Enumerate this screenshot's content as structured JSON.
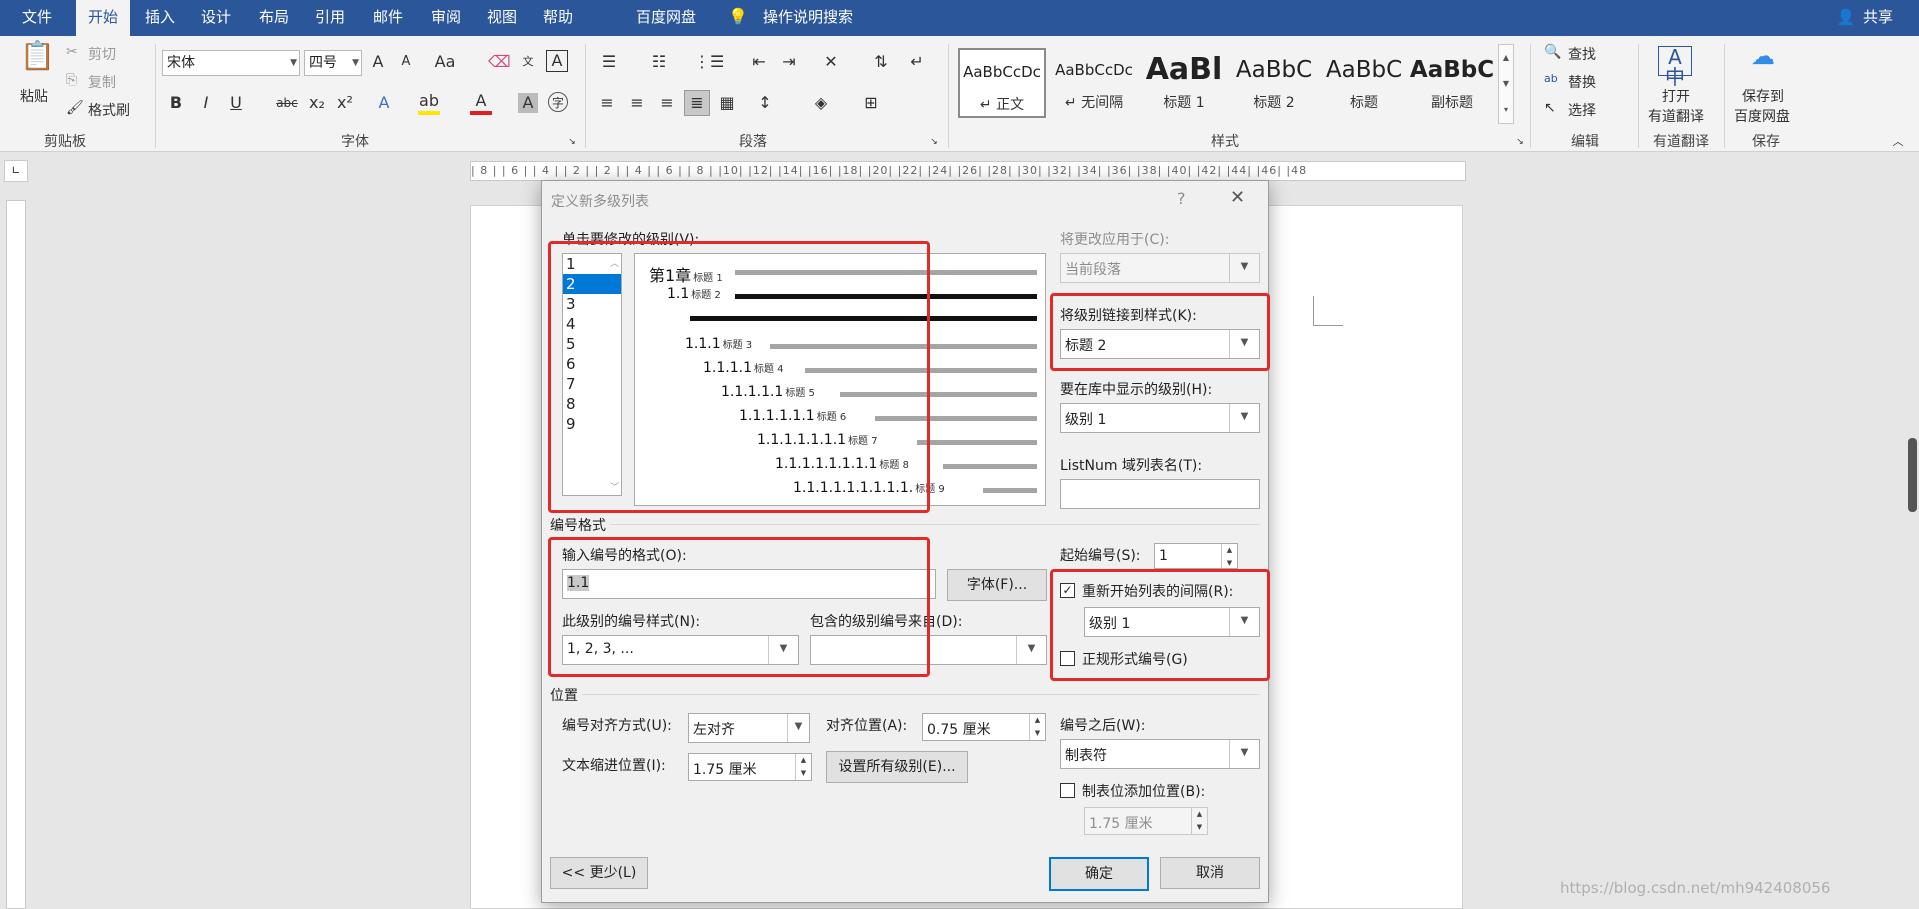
{
  "menubar": {
    "tabs": [
      "文件",
      "开始",
      "插入",
      "设计",
      "布局",
      "引用",
      "邮件",
      "审阅",
      "视图",
      "帮助",
      "百度网盘"
    ],
    "active": "开始",
    "search": "操作说明搜索",
    "share": "共享"
  },
  "ribbon": {
    "clipboard": {
      "paste": "粘贴",
      "cut": "剪切",
      "copy": "复制",
      "format_painter": "格式刷",
      "label": "剪贴板"
    },
    "font": {
      "name": "宋体",
      "size": "四号",
      "label": "字体",
      "grow": "A",
      "shrink": "A",
      "case": "Aa",
      "bold": "B",
      "italic": "I",
      "underline": "U",
      "strike": "abc",
      "sub": "x₂",
      "sup": "x²"
    },
    "paragraph": {
      "label": "段落"
    },
    "styles": {
      "label": "样式",
      "items": [
        {
          "preview": "AaBbCcDc",
          "name": "↵ 正文"
        },
        {
          "preview": "AaBbCcDc",
          "name": "↵ 无间隔"
        },
        {
          "preview": "AaBl",
          "name": "标题 1"
        },
        {
          "preview": "AaBbC",
          "name": "标题 2"
        },
        {
          "preview": "AaBbC",
          "name": "标题"
        },
        {
          "preview": "AaBbC",
          "name": "副标题"
        }
      ]
    },
    "editing": {
      "find": "查找",
      "replace": "替换",
      "select": "选择",
      "label": "编辑"
    },
    "youdao": {
      "open": "打开",
      "translate": "有道翻译",
      "label": "有道翻译"
    },
    "baidu": {
      "save": "保存到",
      "disk": "百度网盘",
      "label": "保存"
    }
  },
  "ruler": {
    "text": "| 8 |  | 6 |  | 4 |  | 2 |      | 2 |  | 4 |  | 6 |  | 8 |  |10|  |12|  |14|  |16|  |18|  |20|  |22|  |24|  |26|  |28|  |30|  |32|  |34|  |36|  |38|      |40|  |42|  |44|  |46|  |48"
  },
  "dialog": {
    "title": "定义新多级列表",
    "help": "?",
    "close": "✕",
    "level_label": "单击要修改的级别(V):",
    "levels": [
      "1",
      "2",
      "3",
      "4",
      "5",
      "6",
      "7",
      "8",
      "9"
    ],
    "selected_level": "2",
    "preview": [
      {
        "num": "第1章",
        "tag": "标题 1"
      },
      {
        "num": "1.1",
        "tag": "标题 2"
      },
      {
        "num": "1.1.1",
        "tag": "标题 3"
      },
      {
        "num": "1.1.1.1",
        "tag": "标题 4"
      },
      {
        "num": "1.1.1.1.1",
        "tag": "标题 5"
      },
      {
        "num": "1.1.1.1.1.1",
        "tag": "标题 6"
      },
      {
        "num": "1.1.1.1.1.1.1",
        "tag": "标题 7"
      },
      {
        "num": "1.1.1.1.1.1.1.1",
        "tag": "标题 8"
      },
      {
        "num": "1.1.1.1.1.1.1.1.1.",
        "tag": "标题 9"
      }
    ],
    "apply_to_label": "将更改应用于(C):",
    "apply_to_value": "当前段落",
    "link_style_label": "将级别链接到样式(K):",
    "link_style_value": "标题 2",
    "gallery_level_label": "要在库中显示的级别(H):",
    "gallery_level_value": "级别 1",
    "listnum_label": "ListNum 域列表名(T):",
    "listnum_value": "",
    "number_format_section": "编号格式",
    "enter_format_label": "输入编号的格式(O):",
    "enter_format_value": "1.1",
    "font_button": "字体(F)...",
    "number_style_label": "此级别的编号样式(N):",
    "number_style_value": "1, 2, 3, ...",
    "include_from_label": "包含的级别编号来自(D):",
    "include_from_value": "",
    "start_at_label": "起始编号(S):",
    "start_at_value": "1",
    "restart_label": "重新开始列表的间隔(R):",
    "restart_checked": true,
    "restart_value": "级别 1",
    "legal_label": "正规形式编号(G)",
    "legal_checked": false,
    "position_section": "位置",
    "alignment_label": "编号对齐方式(U):",
    "alignment_value": "左对齐",
    "aligned_at_label": "对齐位置(A):",
    "aligned_at_value": "0.75 厘米",
    "indent_label": "文本缩进位置(I):",
    "indent_value": "1.75 厘米",
    "set_all_button": "设置所有级别(E)...",
    "follow_label": "编号之后(W):",
    "follow_value": "制表符",
    "tab_add_label": "制表位添加位置(B):",
    "tab_add_checked": false,
    "tab_add_value": "1.75 厘米",
    "less_button": "<< 更少(L)",
    "ok_button": "确定",
    "cancel_button": "取消"
  },
  "watermark": "https://blog.csdn.net/mh942408056"
}
